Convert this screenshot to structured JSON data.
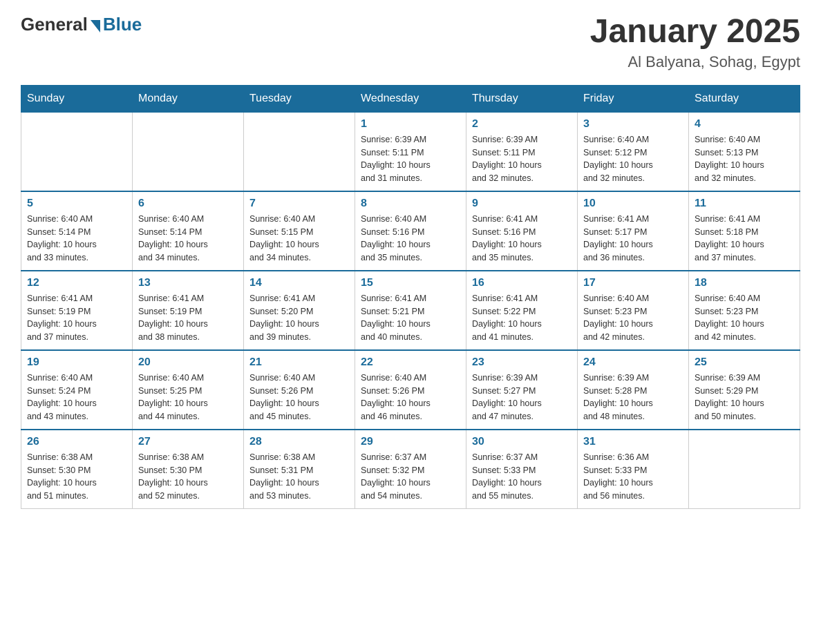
{
  "header": {
    "logo_general": "General",
    "logo_blue": "Blue",
    "month_title": "January 2025",
    "location": "Al Balyana, Sohag, Egypt"
  },
  "weekdays": [
    "Sunday",
    "Monday",
    "Tuesday",
    "Wednesday",
    "Thursday",
    "Friday",
    "Saturday"
  ],
  "weeks": [
    [
      {
        "day": "",
        "info": ""
      },
      {
        "day": "",
        "info": ""
      },
      {
        "day": "",
        "info": ""
      },
      {
        "day": "1",
        "info": "Sunrise: 6:39 AM\nSunset: 5:11 PM\nDaylight: 10 hours\nand 31 minutes."
      },
      {
        "day": "2",
        "info": "Sunrise: 6:39 AM\nSunset: 5:11 PM\nDaylight: 10 hours\nand 32 minutes."
      },
      {
        "day": "3",
        "info": "Sunrise: 6:40 AM\nSunset: 5:12 PM\nDaylight: 10 hours\nand 32 minutes."
      },
      {
        "day": "4",
        "info": "Sunrise: 6:40 AM\nSunset: 5:13 PM\nDaylight: 10 hours\nand 32 minutes."
      }
    ],
    [
      {
        "day": "5",
        "info": "Sunrise: 6:40 AM\nSunset: 5:14 PM\nDaylight: 10 hours\nand 33 minutes."
      },
      {
        "day": "6",
        "info": "Sunrise: 6:40 AM\nSunset: 5:14 PM\nDaylight: 10 hours\nand 34 minutes."
      },
      {
        "day": "7",
        "info": "Sunrise: 6:40 AM\nSunset: 5:15 PM\nDaylight: 10 hours\nand 34 minutes."
      },
      {
        "day": "8",
        "info": "Sunrise: 6:40 AM\nSunset: 5:16 PM\nDaylight: 10 hours\nand 35 minutes."
      },
      {
        "day": "9",
        "info": "Sunrise: 6:41 AM\nSunset: 5:16 PM\nDaylight: 10 hours\nand 35 minutes."
      },
      {
        "day": "10",
        "info": "Sunrise: 6:41 AM\nSunset: 5:17 PM\nDaylight: 10 hours\nand 36 minutes."
      },
      {
        "day": "11",
        "info": "Sunrise: 6:41 AM\nSunset: 5:18 PM\nDaylight: 10 hours\nand 37 minutes."
      }
    ],
    [
      {
        "day": "12",
        "info": "Sunrise: 6:41 AM\nSunset: 5:19 PM\nDaylight: 10 hours\nand 37 minutes."
      },
      {
        "day": "13",
        "info": "Sunrise: 6:41 AM\nSunset: 5:19 PM\nDaylight: 10 hours\nand 38 minutes."
      },
      {
        "day": "14",
        "info": "Sunrise: 6:41 AM\nSunset: 5:20 PM\nDaylight: 10 hours\nand 39 minutes."
      },
      {
        "day": "15",
        "info": "Sunrise: 6:41 AM\nSunset: 5:21 PM\nDaylight: 10 hours\nand 40 minutes."
      },
      {
        "day": "16",
        "info": "Sunrise: 6:41 AM\nSunset: 5:22 PM\nDaylight: 10 hours\nand 41 minutes."
      },
      {
        "day": "17",
        "info": "Sunrise: 6:40 AM\nSunset: 5:23 PM\nDaylight: 10 hours\nand 42 minutes."
      },
      {
        "day": "18",
        "info": "Sunrise: 6:40 AM\nSunset: 5:23 PM\nDaylight: 10 hours\nand 42 minutes."
      }
    ],
    [
      {
        "day": "19",
        "info": "Sunrise: 6:40 AM\nSunset: 5:24 PM\nDaylight: 10 hours\nand 43 minutes."
      },
      {
        "day": "20",
        "info": "Sunrise: 6:40 AM\nSunset: 5:25 PM\nDaylight: 10 hours\nand 44 minutes."
      },
      {
        "day": "21",
        "info": "Sunrise: 6:40 AM\nSunset: 5:26 PM\nDaylight: 10 hours\nand 45 minutes."
      },
      {
        "day": "22",
        "info": "Sunrise: 6:40 AM\nSunset: 5:26 PM\nDaylight: 10 hours\nand 46 minutes."
      },
      {
        "day": "23",
        "info": "Sunrise: 6:39 AM\nSunset: 5:27 PM\nDaylight: 10 hours\nand 47 minutes."
      },
      {
        "day": "24",
        "info": "Sunrise: 6:39 AM\nSunset: 5:28 PM\nDaylight: 10 hours\nand 48 minutes."
      },
      {
        "day": "25",
        "info": "Sunrise: 6:39 AM\nSunset: 5:29 PM\nDaylight: 10 hours\nand 50 minutes."
      }
    ],
    [
      {
        "day": "26",
        "info": "Sunrise: 6:38 AM\nSunset: 5:30 PM\nDaylight: 10 hours\nand 51 minutes."
      },
      {
        "day": "27",
        "info": "Sunrise: 6:38 AM\nSunset: 5:30 PM\nDaylight: 10 hours\nand 52 minutes."
      },
      {
        "day": "28",
        "info": "Sunrise: 6:38 AM\nSunset: 5:31 PM\nDaylight: 10 hours\nand 53 minutes."
      },
      {
        "day": "29",
        "info": "Sunrise: 6:37 AM\nSunset: 5:32 PM\nDaylight: 10 hours\nand 54 minutes."
      },
      {
        "day": "30",
        "info": "Sunrise: 6:37 AM\nSunset: 5:33 PM\nDaylight: 10 hours\nand 55 minutes."
      },
      {
        "day": "31",
        "info": "Sunrise: 6:36 AM\nSunset: 5:33 PM\nDaylight: 10 hours\nand 56 minutes."
      },
      {
        "day": "",
        "info": ""
      }
    ]
  ]
}
